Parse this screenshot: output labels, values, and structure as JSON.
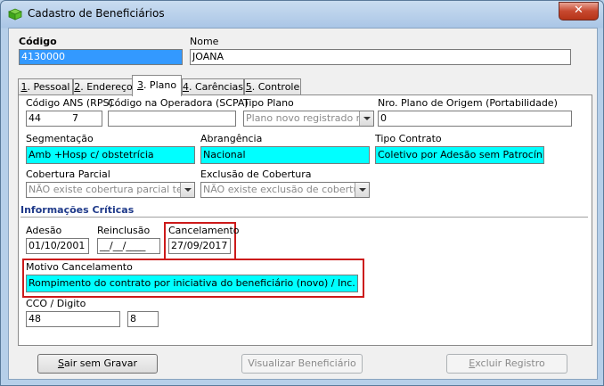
{
  "window": {
    "title": "Cadastro de Beneficiários",
    "close_label": "✕"
  },
  "header": {
    "codigo_label": "Código",
    "codigo_value": "4130000",
    "nome_label": "Nome",
    "nome_value": "JOANA"
  },
  "tabs": [
    {
      "num": "1",
      "label": ". Pessoal"
    },
    {
      "num": "2",
      "label": ". Endereço"
    },
    {
      "num": "3",
      "label": ". Plano"
    },
    {
      "num": "4",
      "label": ". Carências"
    },
    {
      "num": "5",
      "label": ". Controle"
    }
  ],
  "plano": {
    "ans_label": "Código ANS (RPS)",
    "ans_value": "44          7",
    "operadora_label": "Código na Operadora (SCPA)",
    "operadora_value": "",
    "tipo_plano_label": "Tipo Plano",
    "tipo_plano_value": "Plano novo registrado na",
    "nro_plano_label": "Nro. Plano de Origem (Portabilidade)",
    "nro_plano_value": "0",
    "segmentacao_label": "Segmentação",
    "segmentacao_value": "Amb +Hosp c/ obstetrícia",
    "abrangencia_label": "Abrangência",
    "abrangencia_value": "Nacional",
    "tipo_contrato_label": "Tipo Contrato",
    "tipo_contrato_value": "Coletivo por Adesão sem Patrocínio",
    "cobertura_label": "Cobertura Parcial",
    "cobertura_value": "NÃO existe cobertura parcial temp",
    "exclusao_label": "Exclusão de Cobertura",
    "exclusao_value": "NÃO existe exclusão de cobertura"
  },
  "criticas": {
    "title": "Informações Críticas",
    "adesao_label": "Adesão",
    "adesao_value": "01/10/2001",
    "reinclusao_label": "Reinclusão",
    "reinclusao_value": "__/__/____",
    "cancelamento_label": "Cancelamento",
    "cancelamento_value": "27/09/2017",
    "motivo_label": "Motivo Cancelamento",
    "motivo_value": "Rompimento do contrato por iniciativa do beneficiário (novo) / Inc. por Port.",
    "cco_label": "CCO / Digito",
    "cco_value": "48",
    "digito_value": "8"
  },
  "buttons": {
    "sair_u": "S",
    "sair_rest": "air sem Gravar",
    "visualizar": "Visualizar Beneficiário",
    "excluir_u": "E",
    "excluir_rest": "xcluir Registro"
  },
  "colors": {
    "highlight_field": "#00ffff",
    "annotation_box": "#cc1a1a",
    "section_title": "#1f3a8a"
  }
}
